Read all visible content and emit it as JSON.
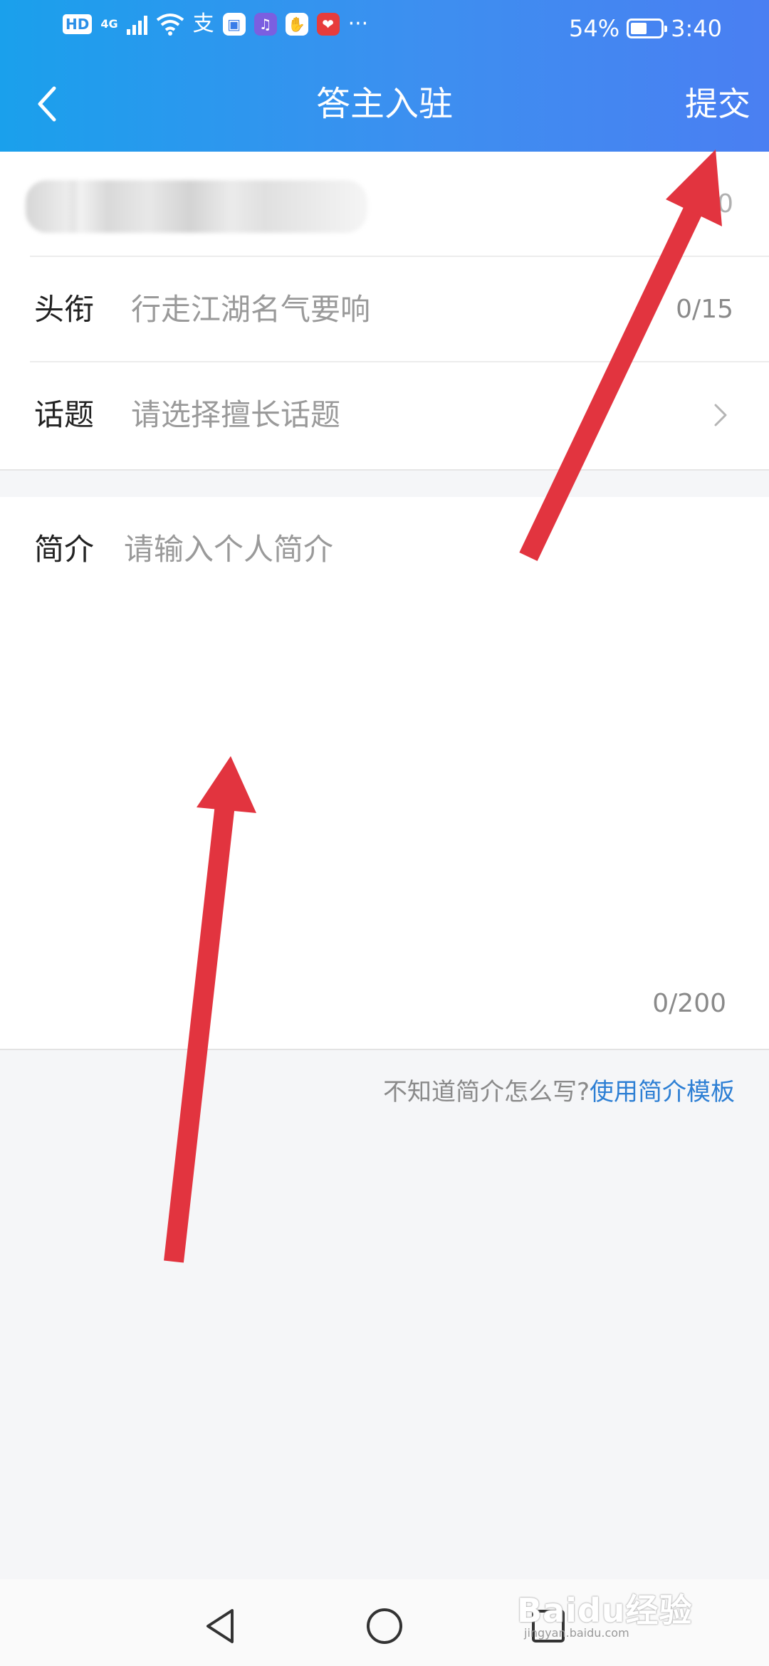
{
  "status_bar": {
    "network_type": "4G",
    "battery": "54%",
    "battery_level": 0.54,
    "time": "3:40"
  },
  "header": {
    "title": "答主入驻",
    "submit_label": "提交",
    "back_icon": "chevron-left-icon"
  },
  "form": {
    "name_counter": "10",
    "title_label": "头衔",
    "title_placeholder": "行走江湖名气要响",
    "title_counter": "0/15",
    "topic_label": "话题",
    "topic_placeholder": "请选择擅长话题",
    "bio_label": "简介",
    "bio_placeholder": "请输入个人简介",
    "bio_counter": "0/200"
  },
  "hint": {
    "question": "不知道简介怎么写?",
    "link": "使用简介模板"
  },
  "watermark": {
    "text": "Baidu经验",
    "sub": "jingyan.baidu.com"
  },
  "colors": {
    "header_start": "#1aa0ec",
    "header_end": "#4a7ff2",
    "link": "#2d7fd4",
    "annotation_arrow": "#e2343f"
  }
}
